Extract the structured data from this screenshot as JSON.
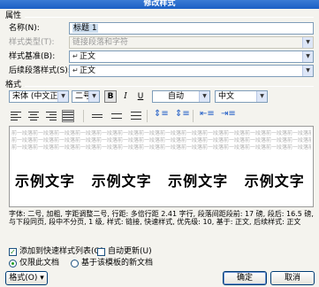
{
  "window": {
    "title": "修改样式"
  },
  "properties": {
    "heading": "属性",
    "name_label": "名称(N):",
    "name_value": "标题 1",
    "style_type_label": "样式类型(T):",
    "style_type_value": "链接段落和字符",
    "based_on_label": "样式基准(B):",
    "based_on_value": "正文",
    "next_style_label": "后续段落样式(S):",
    "next_style_value": "正文"
  },
  "format": {
    "heading": "格式",
    "font": "宋体 (中文正文",
    "size": "二号",
    "bold": "B",
    "italic": "I",
    "underline": "U",
    "color": "自动",
    "language": "中文"
  },
  "preview": {
    "prev_para_text": "前一段落前一段落前一段落前一段落前一段落前一段落前一段落前一段落前一段落前一段落前一段落前一段落前一段落前一段落前一段落前一段落",
    "sample_text": "示例文字 示例文字 示例文字 示例文字"
  },
  "description": "字体: 二号, 加粗, 字距调整二号, 行距: 多倍行距 2.41 字行, 段落间距段前: 17 磅, 段后: 16.5 磅, 与下段同页, 段中不分页, 1 级, 样式: 链接, 快速样式, 优先级: 10, 基于: 正文, 后续样式: 正文",
  "options": {
    "add_quick_style": "添加到快速样式列表(Q)",
    "auto_update": "自动更新(U)",
    "only_this_doc": "仅限此文档",
    "new_docs_template": "基于该模板的新文档"
  },
  "buttons": {
    "format": "格式(O) ▾",
    "ok": "确定",
    "cancel": "取消"
  }
}
